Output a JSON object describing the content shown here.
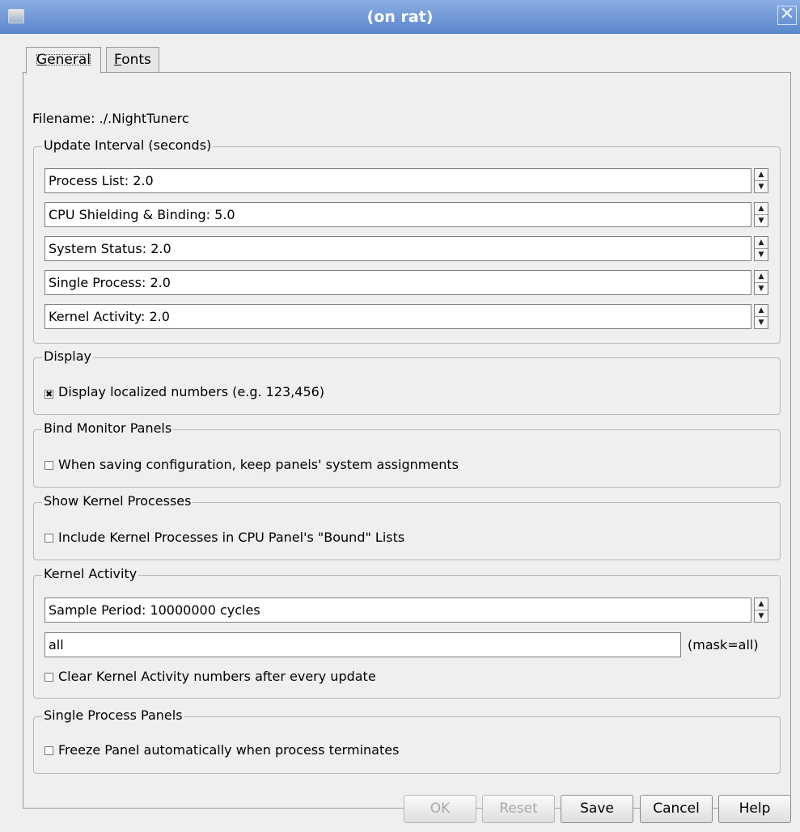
{
  "window": {
    "title": "(on rat)",
    "close_glyph": "✕"
  },
  "tabs": [
    {
      "label": "General",
      "mnemonic": "G",
      "rest": "eneral",
      "active": true
    },
    {
      "label": "Fonts",
      "mnemonic": "F",
      "rest": "onts",
      "active": false
    }
  ],
  "filename": "Filename:  ./.NightTunerc",
  "update_interval": {
    "title": "Update Interval (seconds)",
    "fields": [
      "Process List: 2.0",
      "CPU Shielding & Binding: 5.0",
      "System Status: 2.0",
      "Single Process: 2.0",
      "Kernel Activity: 2.0"
    ]
  },
  "display": {
    "title": "Display",
    "checkbox_label": "Display localized numbers (e.g. 123,456)",
    "checked": true
  },
  "bind_monitor": {
    "title": "Bind Monitor Panels",
    "checkbox_label": "When saving configuration, keep panels' system assignments",
    "checked": false
  },
  "show_kernel": {
    "title": "Show Kernel Processes",
    "checkbox_label": "Include Kernel Processes in CPU Panel's \"Bound\" Lists",
    "checked": false
  },
  "kernel_activity": {
    "title": "Kernel Activity",
    "sample_period": "Sample Period: 10000000 cycles",
    "mask_value": "all",
    "mask_label": "(mask=all)",
    "checkbox_label": "Clear Kernel Activity numbers after every update",
    "checked": false
  },
  "single_process": {
    "title": "Single Process Panels",
    "checkbox_label": "Freeze Panel automatically when process terminates",
    "checked": false
  },
  "buttons": {
    "ok": "OK",
    "reset": "Reset",
    "save": "Save",
    "cancel": "Cancel",
    "help": "Help"
  },
  "check_glyph": "✖"
}
